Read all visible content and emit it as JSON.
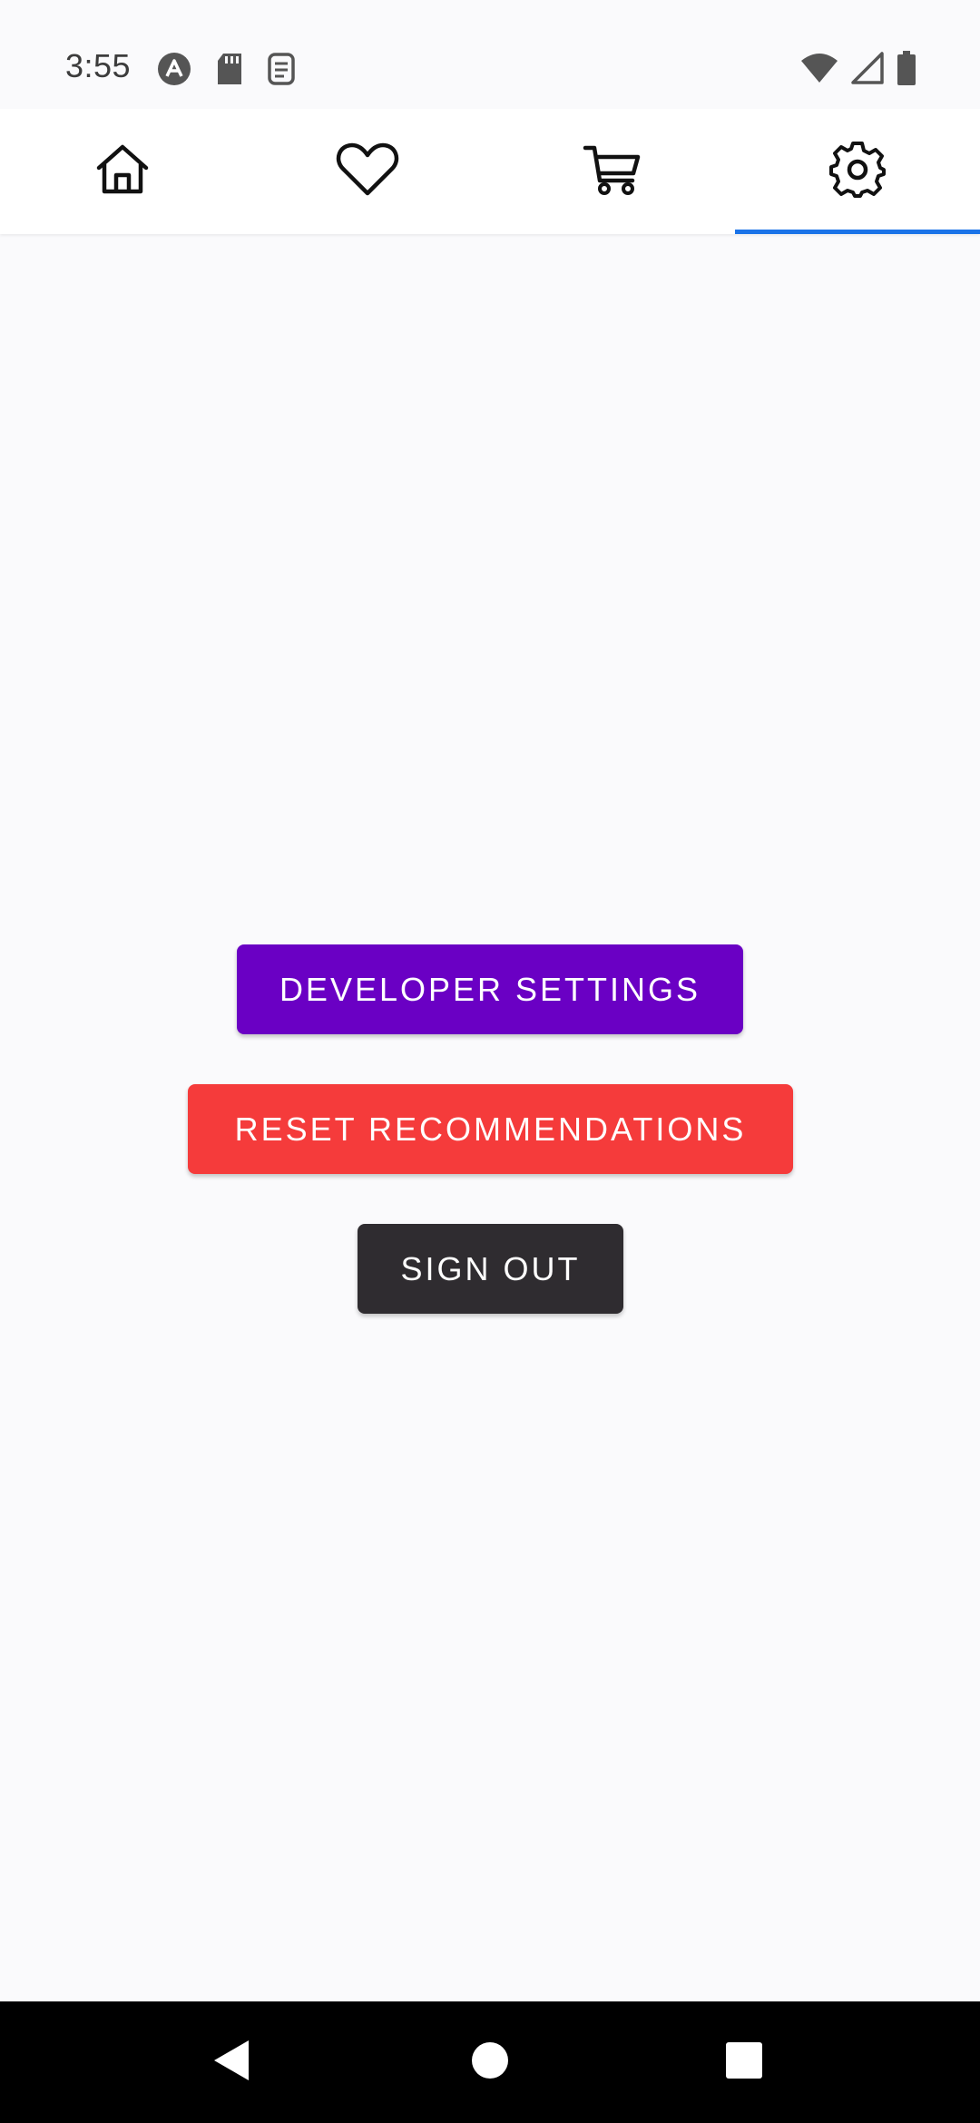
{
  "status_bar": {
    "time": "3:55",
    "left_icons": [
      "android-auto-icon",
      "sd-card-icon",
      "sim-icon"
    ],
    "right_icons": [
      "wifi-icon",
      "cell-signal-icon",
      "battery-icon"
    ]
  },
  "tabs": [
    {
      "name": "home",
      "icon": "home-icon",
      "active": false
    },
    {
      "name": "favorites",
      "icon": "heart-icon",
      "active": false
    },
    {
      "name": "cart",
      "icon": "cart-icon",
      "active": false
    },
    {
      "name": "settings",
      "icon": "gear-icon",
      "active": true
    }
  ],
  "colors": {
    "tab_indicator": "#1a73e8",
    "developer_button": "#6a00c4",
    "reset_button": "#f53b3b",
    "signout_button": "#2f2c30",
    "background": "#fafafc"
  },
  "settings": {
    "developer_label": "DEVELOPER SETTINGS",
    "reset_label": "RESET RECOMMENDATIONS",
    "signout_label": "SIGN OUT"
  },
  "nav_bar": {
    "buttons": [
      "back-icon",
      "home-circle-icon",
      "recents-icon"
    ]
  }
}
